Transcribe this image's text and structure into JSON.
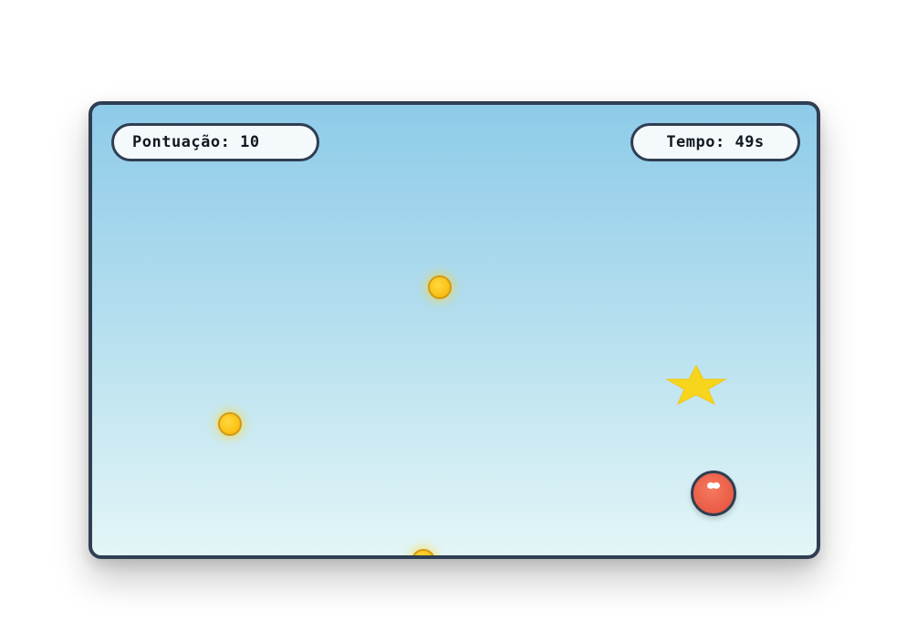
{
  "hud": {
    "score_text": "Pontuação: 10",
    "time_text": "Tempo: 49s"
  },
  "colors": {
    "frame": "#2f3e52",
    "sky_top": "#8ecbe9",
    "sky_bottom": "#e3f6f7",
    "coin": "#fbc21a",
    "star": "#f7d51d",
    "player": "#ea5b45"
  },
  "entities": {
    "coins": 3,
    "stars": 1,
    "player": "red-ball"
  }
}
